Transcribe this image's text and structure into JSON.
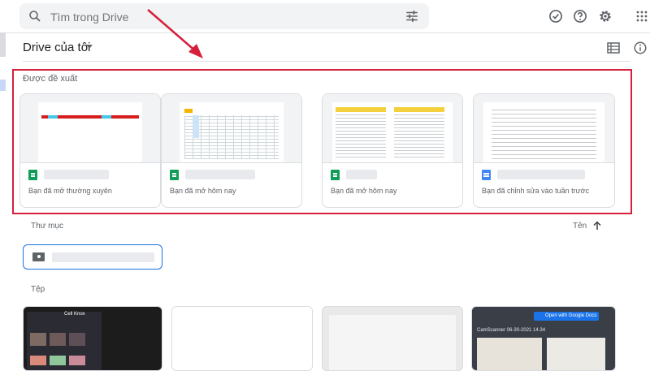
{
  "search": {
    "placeholder": "Tìm trong Drive"
  },
  "header": {
    "title": "Drive của tôi"
  },
  "suggested": {
    "title": "Được đề xuất",
    "cards": [
      {
        "type": "sheet",
        "activity": "Bạn đã mở thường xuyên"
      },
      {
        "type": "sheet",
        "activity": "Bạn đã mở hôm nay"
      },
      {
        "type": "sheet",
        "activity": "Bạn đã mở hôm nay"
      },
      {
        "type": "docs",
        "activity": "Bạn đã chỉnh sửa vào tuần trước"
      }
    ]
  },
  "folders": {
    "title": "Thư mục",
    "sort_label": "Tên"
  },
  "files": {
    "title": "Tệp",
    "items": [
      {
        "tag": "Cell Knox"
      },
      {
        "tag": ""
      },
      {
        "tag": ""
      },
      {
        "tag": "Open with Google Docs",
        "sub": "CamScanner 06-30-2021 14.34"
      }
    ]
  },
  "colors": {
    "highlight": "#d6203c",
    "accent": "#1a73e8",
    "sheets": "#0f9d58",
    "docs": "#4285f4"
  },
  "icons": [
    "search-icon",
    "tune-icon",
    "check-circle-icon",
    "help-icon",
    "gear-icon",
    "apps-icon",
    "list-view-icon",
    "info-icon",
    "sort-arrow-icon",
    "folder-shared-icon"
  ]
}
